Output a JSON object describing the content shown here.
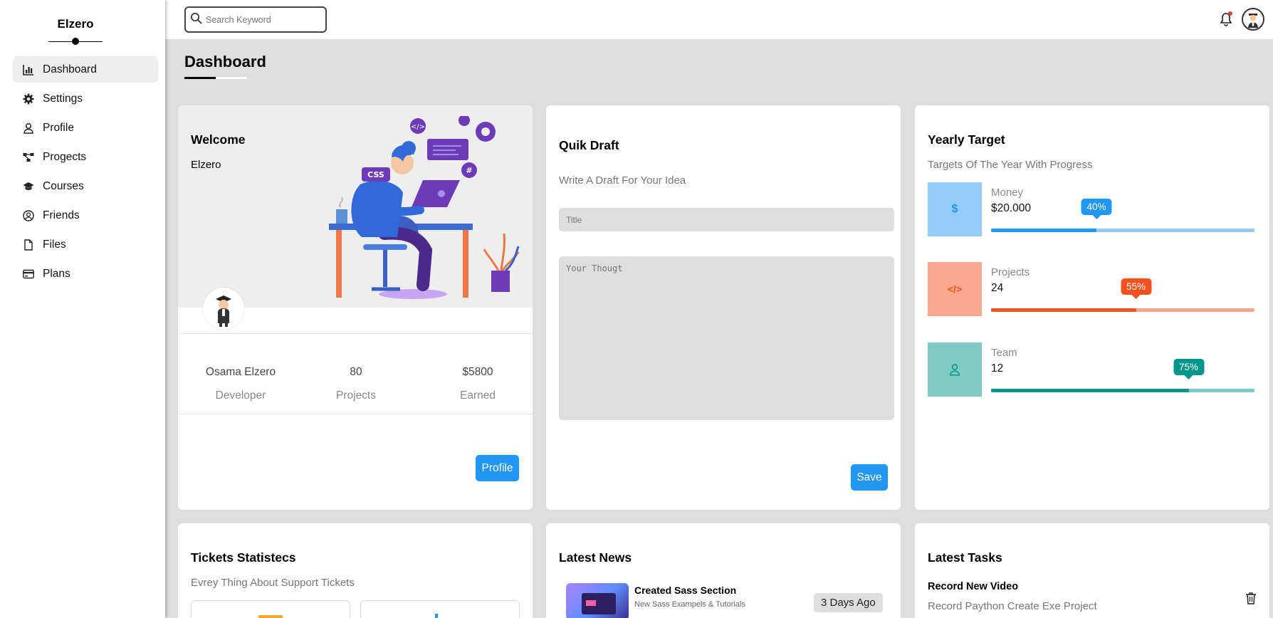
{
  "sidebar": {
    "brand": "Elzero",
    "items": [
      {
        "label": "Dashboard",
        "icon": "chart-icon"
      },
      {
        "label": "Settings",
        "icon": "gear-icon"
      },
      {
        "label": "Profile",
        "icon": "user-icon"
      },
      {
        "label": "Progects",
        "icon": "diagram-icon"
      },
      {
        "label": "Courses",
        "icon": "graduation-cap-icon"
      },
      {
        "label": "Friends",
        "icon": "user-circle-icon"
      },
      {
        "label": "Files",
        "icon": "file-icon"
      },
      {
        "label": "Plans",
        "icon": "credit-card-icon"
      }
    ]
  },
  "header": {
    "search_placeholder": "Search Keyword"
  },
  "page": {
    "title": "Dashboard"
  },
  "welcome": {
    "title": "Welcome",
    "name": "Elzero",
    "stats": [
      {
        "value": "Osama Elzero",
        "label": "Developer"
      },
      {
        "value": "80",
        "label": "Projects"
      },
      {
        "value": "$5800",
        "label": "Earned"
      }
    ],
    "button": "Profile"
  },
  "draft": {
    "title": "Quik Draft",
    "subtitle": "Write A Draft For Your Idea",
    "title_placeholder": "Title",
    "body_placeholder": "Your Thougt",
    "button": "Save"
  },
  "targets": {
    "title": "Yearly Target",
    "subtitle": "Targets Of The Year With Progress",
    "items": [
      {
        "name": "Money",
        "value": "$20.000",
        "progress_label": "40%",
        "progress": 0.4,
        "icon_text": "$",
        "color": "#2296f3",
        "light": "#94cbf8"
      },
      {
        "name": "Projects",
        "value": "24",
        "progress_label": "55%",
        "progress": 0.55,
        "icon_text": "</>",
        "color": "#f4511e",
        "light": "#f9a88e"
      },
      {
        "name": "Team",
        "value": "12",
        "progress_label": "75%",
        "progress": 0.75,
        "icon_text": "user",
        "color": "#009688",
        "light": "#7fcac3"
      }
    ]
  },
  "tickets": {
    "title": "Tickets Statistecs",
    "subtitle": "Evrey Thing About Support Tickets"
  },
  "news": {
    "title": "Latest News",
    "item_title": "Created Sass Section",
    "item_desc": "New Sass Exampels & Tutorials",
    "item_time": "3 Days Ago"
  },
  "tasks": {
    "title": "Latest Tasks",
    "item_title": "Record New Video",
    "item_desc": "Record Paython Create Exe Project"
  }
}
